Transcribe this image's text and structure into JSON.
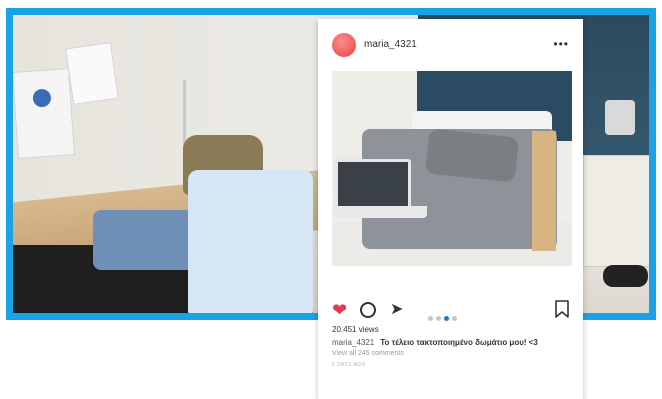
{
  "post": {
    "username": "maria_4321",
    "views": "20.451 views",
    "caption_user": "maria_4321",
    "caption_text": "Το τέλειο τακτοποιημένο δωμάτιο μου! <3",
    "comments_link": "View all 245 comments",
    "timestamp": "2 DAYS AGO",
    "carousel": {
      "total": 4,
      "active_index": 2
    }
  },
  "icons": {
    "more": "more-icon",
    "like": "heart-icon",
    "comment": "comment-icon",
    "share": "send-icon",
    "save": "bookmark-icon"
  },
  "colors": {
    "frame": "#19a3e6",
    "like": "#e23a4d",
    "carousel_active": "#1d77d1",
    "avatar": "#e64545"
  }
}
